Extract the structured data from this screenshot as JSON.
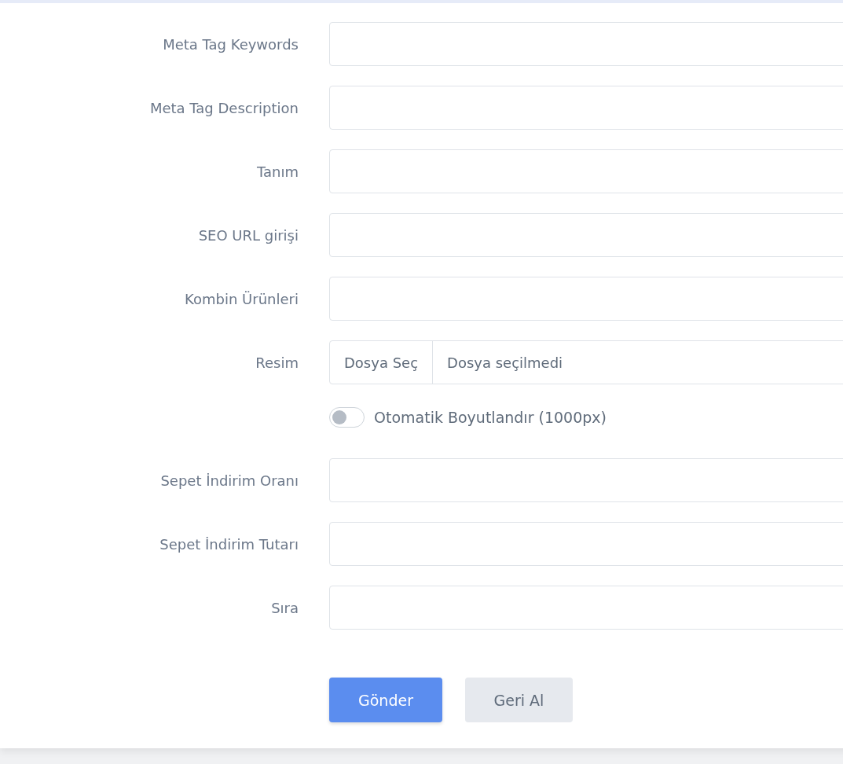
{
  "form": {
    "fields": [
      {
        "kind": "text",
        "label": "Meta Tag Keywords"
      },
      {
        "kind": "text",
        "label": "Meta Tag Description"
      },
      {
        "kind": "text",
        "label": "Tanım"
      },
      {
        "kind": "text",
        "label": "SEO URL girişi"
      },
      {
        "kind": "text",
        "label": "Kombin Ürünleri"
      },
      {
        "kind": "file",
        "label": "Resim",
        "button": "Dosya Seç",
        "status": "Dosya seçilmedi"
      },
      {
        "kind": "toggle",
        "label": "Otomatik Boyutlandır (1000px)",
        "on": false
      },
      {
        "kind": "text",
        "label": "Sepet İndirim Oranı"
      },
      {
        "kind": "text",
        "label": "Sepet İndirim Tutarı"
      },
      {
        "kind": "text",
        "label": "Sıra"
      }
    ],
    "buttons": [
      {
        "label": "Gönder",
        "kind": "primary"
      },
      {
        "label": "Geri Al",
        "kind": "secondary"
      }
    ]
  }
}
